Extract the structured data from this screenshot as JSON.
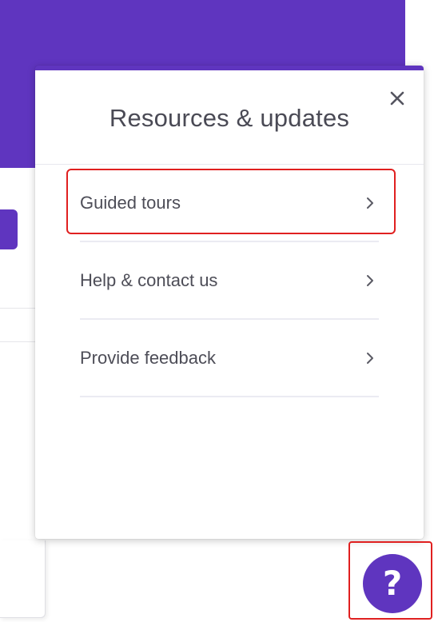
{
  "panel": {
    "title": "Resources & updates",
    "close_icon": "close-icon",
    "items": [
      {
        "label": "Guided tours",
        "icon": "chevron-right-icon",
        "highlighted": true
      },
      {
        "label": "Help & contact us",
        "icon": "chevron-right-icon",
        "highlighted": false
      },
      {
        "label": "Provide feedback",
        "icon": "chevron-right-icon",
        "highlighted": false
      }
    ]
  },
  "help_button": {
    "glyph": "?",
    "icon": "question-mark-icon",
    "highlighted": true
  },
  "colors": {
    "brand_purple": "#5f35bf",
    "highlight_red": "#e02020",
    "text_primary": "#4d4d57",
    "title_text": "#4a4a55"
  }
}
